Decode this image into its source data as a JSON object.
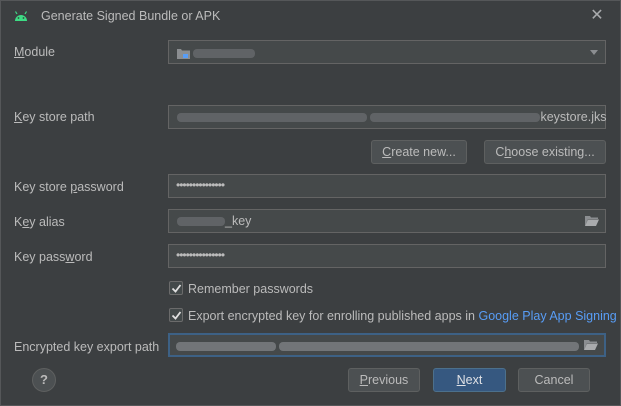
{
  "dialog": {
    "title": "Generate Signed Bundle or APK"
  },
  "module": {
    "label": "Module"
  },
  "keystore_path": {
    "label": "Key store path",
    "value_suffix": "keystore.jks"
  },
  "buttons": {
    "create_new": "Create new...",
    "choose_existing": "Choose existing...",
    "previous": "Previous",
    "next": "Next",
    "cancel": "Cancel",
    "help": "?"
  },
  "keystore_password": {
    "label": "Key store password",
    "value": "•••••••••••••••"
  },
  "key_alias": {
    "label": "Key alias",
    "value_suffix": "_key"
  },
  "key_password": {
    "label": "Key password",
    "value": "•••••••••••••••"
  },
  "options": {
    "remember_passwords": "Remember passwords",
    "remember_checked": true,
    "export_encrypted": "Export encrypted key for enrolling published apps in",
    "export_checked": true,
    "play_signing_link": "Google Play App Signing"
  },
  "encrypted_export": {
    "label": "Encrypted key export path"
  },
  "colors": {
    "background": "#3c3f41",
    "field": "#45494a",
    "primary_button": "#365880",
    "link": "#589df6"
  }
}
